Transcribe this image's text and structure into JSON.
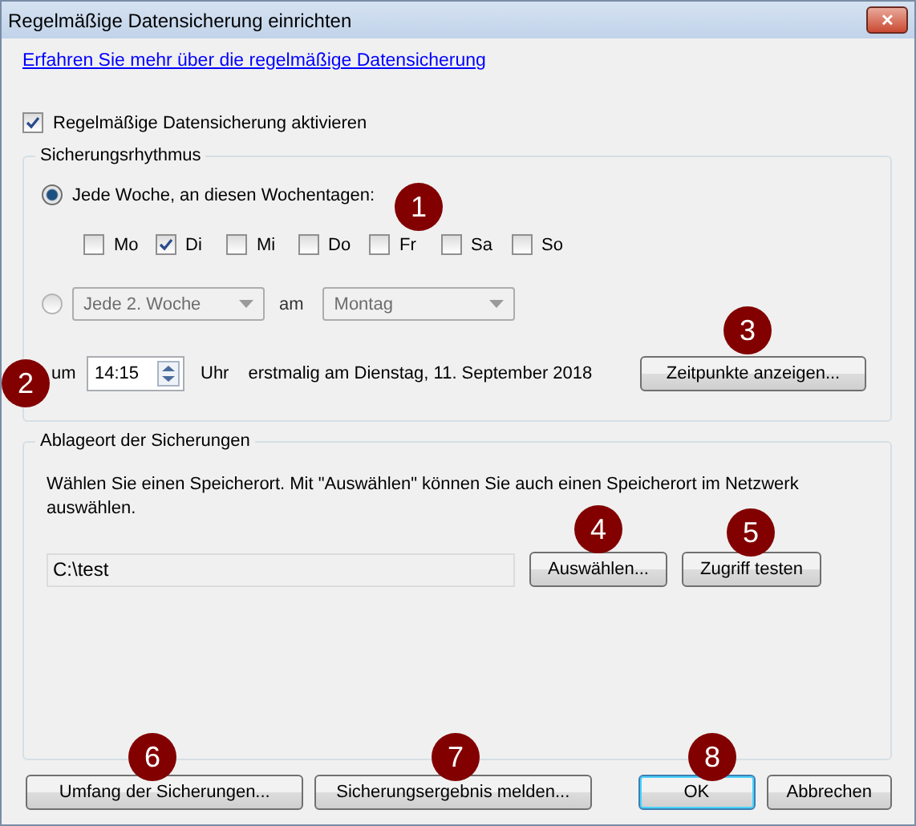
{
  "window": {
    "title": "Regelmäßige Datensicherung einrichten",
    "close": "✕"
  },
  "info_link": "Erfahren Sie mehr über die regelmäßige Datensicherung",
  "enable": {
    "label": "Regelmäßige Datensicherung aktivieren",
    "checked": true
  },
  "schedule": {
    "title": "Sicherungsrhythmus",
    "options": [
      {
        "kind": "weekdays",
        "selected": true,
        "label": "Jede Woche, an diesen Wochentagen:"
      },
      {
        "kind": "interval",
        "selected": false,
        "disabled": true,
        "interval": "Jede 2. Woche",
        "on_label": "am",
        "day": "Montag"
      }
    ],
    "days": [
      {
        "label": "Mo",
        "checked": false
      },
      {
        "label": "Di",
        "checked": true
      },
      {
        "label": "Mi",
        "checked": false
      },
      {
        "label": "Do",
        "checked": false
      },
      {
        "label": "Fr",
        "checked": false
      },
      {
        "label": "Sa",
        "checked": false
      },
      {
        "label": "So",
        "checked": false
      }
    ],
    "time_prefix": "um",
    "time": "14:15",
    "time_suffix": "Uhr",
    "first_run": "erstmalig am Dienstag, 11. September 2018",
    "show_button": "Zeitpunkte anzeigen..."
  },
  "location": {
    "title": "Ablageort der Sicherungen",
    "description": "Wählen Sie einen Speicherort. Mit \"Auswählen\" können Sie auch einen Speicherort im Netzwerk auswählen.",
    "path": "C:\\test",
    "buttons": [
      "Auswählen...",
      "Zugriff testen"
    ]
  },
  "footer_buttons": [
    {
      "label": "Umfang der Sicherungen...",
      "default": false
    },
    {
      "label": "Sicherungsergebnis melden...",
      "default": false
    },
    {
      "label": "OK",
      "default": true
    },
    {
      "label": "Abbrechen",
      "default": false
    }
  ],
  "callouts": [
    {
      "label": "1"
    },
    {
      "label": "2"
    },
    {
      "label": "3"
    },
    {
      "label": "4"
    },
    {
      "label": "5"
    },
    {
      "label": "6"
    },
    {
      "label": "7"
    },
    {
      "label": "8"
    }
  ]
}
